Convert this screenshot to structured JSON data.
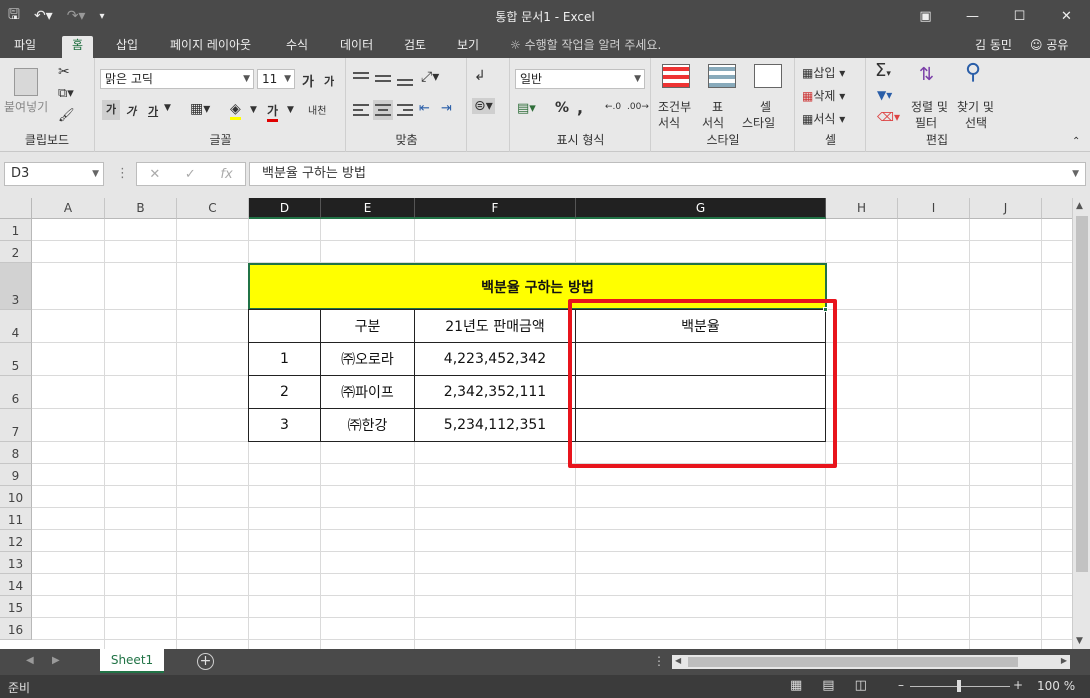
{
  "window": {
    "title": "통합 문서1 - Excel"
  },
  "ribbon_tabs": [
    "파일",
    "홈",
    "삽입",
    "페이지 레이아웃",
    "수식",
    "데이터",
    "검토",
    "보기"
  ],
  "tell_me": "수행할 작업을 알려 주세요.",
  "user": "김 동민",
  "share": "공유",
  "ribbon": {
    "clipboard": {
      "label": "클립보드",
      "paste": "붙여넣기"
    },
    "font": {
      "label": "글꼴",
      "font_name": "맑은 고딕",
      "font_size": "11",
      "grow": "가",
      "shrink": "가",
      "bold": "가",
      "italic": "가",
      "underline": "가",
      "font_color": "가",
      "phonetic": "내천"
    },
    "alignment": {
      "label": "맞춤"
    },
    "number": {
      "label": "표시 형식",
      "format": "일반",
      "percent": "%",
      "comma": ","
    },
    "styles": {
      "label": "스타일",
      "conditional": [
        "조건부",
        "서식"
      ],
      "table": [
        "표",
        "서식"
      ],
      "cell_style": [
        "셀",
        "스타일"
      ]
    },
    "cells": {
      "label": "셀",
      "insert": "삽입",
      "delete": "삭제",
      "format": "서식"
    },
    "editing": {
      "label": "편집",
      "sort": [
        "정렬 및",
        "필터"
      ],
      "find": [
        "찾기 및",
        "선택"
      ]
    }
  },
  "formula_bar": {
    "name_box": "D3",
    "content": "백분율 구하는 방법"
  },
  "columns": [
    "A",
    "B",
    "C",
    "D",
    "E",
    "F",
    "G",
    "H",
    "I",
    "J"
  ],
  "rows": [
    "1",
    "2",
    "3",
    "4",
    "5",
    "6",
    "7",
    "8",
    "9",
    "10",
    "11",
    "12",
    "13",
    "14",
    "15",
    "16"
  ],
  "sheet": {
    "title": "백분율 구하는 방법",
    "headers": [
      "",
      "구분",
      "21년도 판매금액",
      "백분율"
    ],
    "data": [
      {
        "no": "1",
        "name": "㈜오로라",
        "amount": "4,223,452,342",
        "pct": ""
      },
      {
        "no": "2",
        "name": "㈜파이프",
        "amount": "2,342,352,111",
        "pct": ""
      },
      {
        "no": "3",
        "name": "㈜한강",
        "amount": "5,234,112,351",
        "pct": ""
      }
    ]
  },
  "sheet_tabs": [
    "Sheet1"
  ],
  "status": {
    "ready": "준비",
    "zoom": "100 %"
  }
}
